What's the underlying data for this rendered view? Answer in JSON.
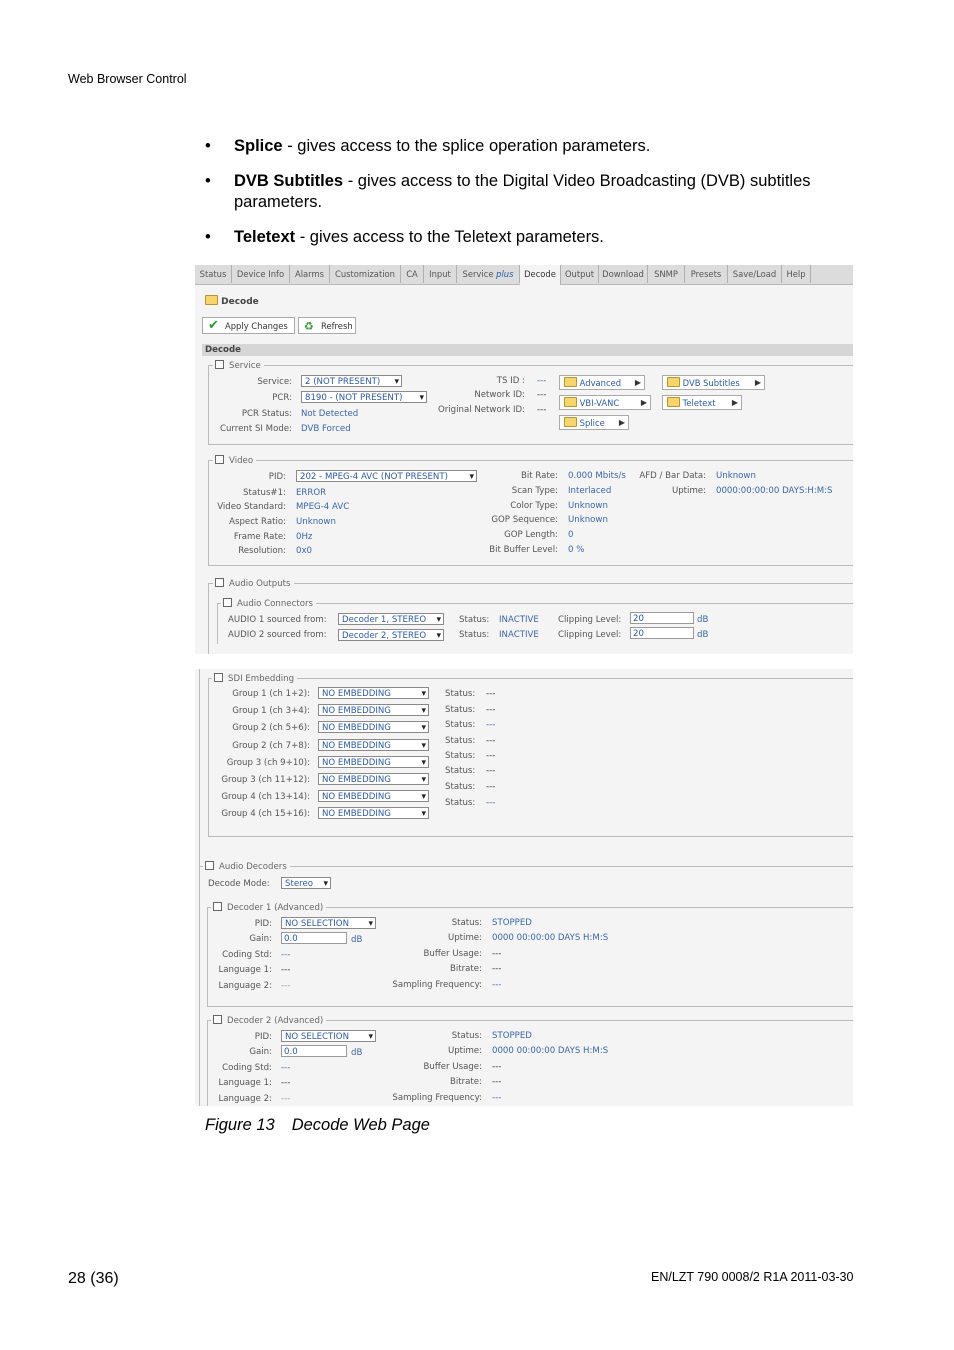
{
  "header": {
    "title": "Web Browser Control"
  },
  "bullets": [
    {
      "term": "Splice",
      "text": " - gives access to the splice operation parameters."
    },
    {
      "term": "DVB Subtitles",
      "text": " - gives access to the Digital Video Broadcasting (DVB) subtitles parameters."
    },
    {
      "term": "Teletext",
      "text": " - gives access to the Teletext parameters."
    }
  ],
  "tabs": [
    "Status",
    "Device Info",
    "Alarms",
    "Customization",
    "CA",
    "Input",
    "Service",
    "Decode",
    "Output",
    "Download",
    "SNMP",
    "Presets",
    "Save/Load",
    "Help"
  ],
  "tab_service_suffix": "plus",
  "page": {
    "title": "Decode",
    "apply_label": "Apply Changes",
    "refresh_label": "Refresh",
    "section_title": "Decode"
  },
  "service": {
    "legend": "Service",
    "service_label": "Service:",
    "service_value": "2 (NOT PRESENT)",
    "pcr_label": "PCR:",
    "pcr_value": "8190 - (NOT PRESENT)",
    "pcr_status_label": "PCR Status:",
    "pcr_status_value": "Not Detected",
    "si_mode_label": "Current SI Mode:",
    "si_mode_value": "DVB Forced",
    "ts_id_label": "TS ID :",
    "ts_id_value": "---",
    "network_id_label": "Network ID:",
    "network_id_value": "---",
    "orig_network_id_label": "Original Network ID:",
    "orig_network_id_value": "---",
    "links": {
      "advanced": "Advanced",
      "dvb_subtitles": "DVB Subtitles",
      "vbi_vanc": "VBI-VANC",
      "teletext": "Teletext",
      "splice": "Splice"
    }
  },
  "video": {
    "legend": "Video",
    "pid_label": "PID:",
    "pid_value": "202 - MPEG-4 AVC (NOT PRESENT)",
    "status_label": "Status#1:",
    "status_value": "ERROR",
    "standard_label": "Video Standard:",
    "standard_value": "MPEG-4 AVC",
    "aspect_label": "Aspect Ratio:",
    "aspect_value": "Unknown",
    "frame_label": "Frame Rate:",
    "frame_value": "0Hz",
    "res_label": "Resolution:",
    "res_value": "0x0",
    "bitrate_label": "Bit Rate:",
    "bitrate_value": "0.000 Mbits/s",
    "scan_label": "Scan Type:",
    "scan_value": "Interlaced",
    "color_label": "Color Type:",
    "color_value": "Unknown",
    "gop_seq_label": "GOP Sequence:",
    "gop_seq_value": "Unknown",
    "gop_len_label": "GOP Length:",
    "gop_len_value": "0",
    "buffer_label": "Bit Buffer Level:",
    "buffer_value": "0 %",
    "afd_label": "AFD / Bar Data:",
    "afd_value": "Unknown",
    "uptime_label": "Uptime:",
    "uptime_value": "0000:00:00:00 DAYS:H:M:S"
  },
  "audio_outputs": {
    "legend": "Audio Outputs",
    "connectors_legend": "Audio Connectors",
    "rows": [
      {
        "label": "AUDIO 1 sourced from:",
        "source": "Decoder 1, STEREO",
        "status_label": "Status:",
        "status": "INACTIVE",
        "clip_label": "Clipping Level:",
        "clip": "20",
        "unit": "dB"
      },
      {
        "label": "AUDIO 2 sourced from:",
        "source": "Decoder 2, STEREO",
        "status_label": "Status:",
        "status": "INACTIVE",
        "clip_label": "Clipping Level:",
        "clip": "20",
        "unit": "dB"
      }
    ]
  },
  "sdi": {
    "legend": "SDI Embedding",
    "rows": [
      {
        "label": "Group 1 (ch 1+2):",
        "value": "NO EMBEDDING"
      },
      {
        "label": "Group 1 (ch 3+4):",
        "value": "NO EMBEDDING"
      },
      {
        "label": "Group 2 (ch 5+6):",
        "value": "NO EMBEDDING"
      },
      {
        "label": "Group 2 (ch 7+8):",
        "value": "NO EMBEDDING"
      },
      {
        "label": "Group 3 (ch 9+10):",
        "value": "NO EMBEDDING"
      },
      {
        "label": "Group 3 (ch 11+12):",
        "value": "NO EMBEDDING"
      },
      {
        "label": "Group 4 (ch 13+14):",
        "value": "NO EMBEDDING"
      },
      {
        "label": "Group 4 (ch 15+16):",
        "value": "NO EMBEDDING"
      }
    ],
    "status_rows": [
      {
        "label": "Status:",
        "value": "---"
      },
      {
        "label": "Status:",
        "value": "---"
      },
      {
        "label": "Status:",
        "value": "---"
      },
      {
        "label": "Status:",
        "value": "---"
      },
      {
        "label": "Status:",
        "value": "---"
      },
      {
        "label": "Status:",
        "value": "---"
      },
      {
        "label": "Status:",
        "value": "---"
      },
      {
        "label": "Status:",
        "value": "---"
      }
    ]
  },
  "audio_decoders": {
    "legend": "Audio Decoders",
    "mode_label": "Decode Mode:",
    "mode_value": "Stereo",
    "decoders": [
      {
        "legend": "Decoder 1 (Advanced)",
        "pid_label": "PID:",
        "pid": "NO SELECTION",
        "gain_label": "Gain:",
        "gain": "0.0",
        "gain_unit": "dB",
        "coding_label": "Coding Std:",
        "coding": "---",
        "lang1_label": "Language 1:",
        "lang1": "---",
        "lang2_label": "Language 2:",
        "lang2": "---",
        "status_label": "Status:",
        "status": "STOPPED",
        "uptime_label": "Uptime:",
        "uptime": "0000 00:00:00 DAYS H:M:S",
        "buffer_label": "Buffer Usage:",
        "buffer": "---",
        "bitrate_label": "Bitrate:",
        "bitrate": "---",
        "freq_label": "Sampling Frequency:",
        "freq": "---"
      },
      {
        "legend": "Decoder 2 (Advanced)",
        "pid_label": "PID:",
        "pid": "NO SELECTION",
        "gain_label": "Gain:",
        "gain": "0.0",
        "gain_unit": "dB",
        "coding_label": "Coding Std:",
        "coding": "---",
        "lang1_label": "Language 1:",
        "lang1": "---",
        "lang2_label": "Language 2:",
        "lang2": "---",
        "status_label": "Status:",
        "status": "STOPPED",
        "uptime_label": "Uptime:",
        "uptime": "0000 00:00:00 DAYS H:M:S",
        "buffer_label": "Buffer Usage:",
        "buffer": "---",
        "bitrate_label": "Bitrate:",
        "bitrate": "---",
        "freq_label": "Sampling Frequency:",
        "freq": "---"
      }
    ]
  },
  "caption": {
    "number": "Figure 13",
    "title": "Decode Web Page"
  },
  "footer": {
    "page": "28 (36)",
    "doc": "EN/LZT 790 0008/2 R1A",
    "date": "2011-03-30"
  }
}
